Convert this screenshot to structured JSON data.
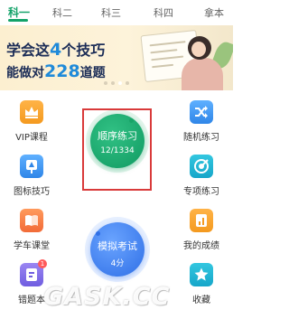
{
  "tabs": [
    {
      "label": "科一",
      "active": true
    },
    {
      "label": "科二"
    },
    {
      "label": "科三"
    },
    {
      "label": "科四"
    },
    {
      "label": "拿本"
    }
  ],
  "banner": {
    "line1_prefix": "学会这",
    "line1_number": "4",
    "line1_suffix": "个技巧",
    "line2_prefix": "能做对",
    "line2_number": "228",
    "line2_suffix": "道题",
    "page_index": 3,
    "page_count": 4
  },
  "left_column": [
    {
      "label": "VIP课程",
      "icon": "crown-icon",
      "color": "#f7a733"
    },
    {
      "label": "图标技巧",
      "icon": "road-sign-icon",
      "color": "#3d97f3"
    },
    {
      "label": "学车课堂",
      "icon": "book-icon",
      "color": "#f5823f"
    },
    {
      "label": "错题本",
      "icon": "error-book-icon",
      "color": "#8573ea",
      "badge": "1"
    }
  ],
  "right_column": [
    {
      "label": "随机练习",
      "icon": "shuffle-icon",
      "color": "#3d97f3"
    },
    {
      "label": "专项练习",
      "icon": "target-icon",
      "color": "#22b6d5"
    },
    {
      "label": "我的成绩",
      "icon": "score-icon",
      "color": "#f7a733"
    },
    {
      "label": "收藏",
      "icon": "star-icon",
      "color": "#22b6d5"
    }
  ],
  "sequential_practice": {
    "title": "顺序练习",
    "progress": "12/1334"
  },
  "mock_exam": {
    "title": "模拟考试",
    "score": "4分"
  },
  "watermark": "GASK.CC",
  "colors": {
    "accent": "#14a36a",
    "highlight_box": "#d93a3a",
    "mock_exam": "#2f6fe6"
  }
}
